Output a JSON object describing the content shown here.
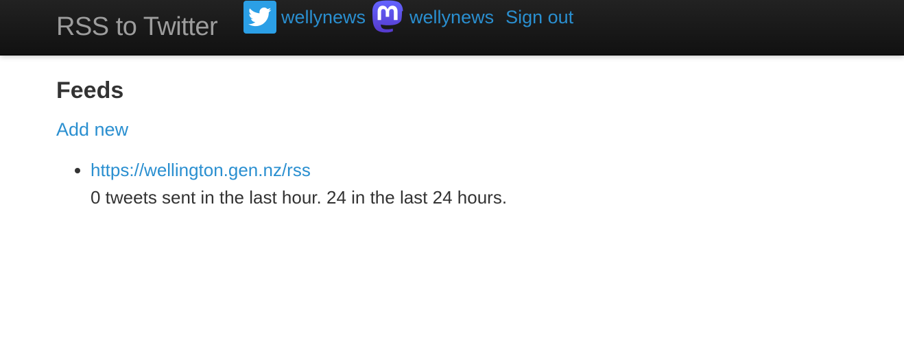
{
  "navbar": {
    "brand": "RSS to Twitter",
    "twitter_account": "wellynews",
    "mastodon_account": "wellynews",
    "sign_out": "Sign out",
    "icons": {
      "twitter": "twitter-bird-icon",
      "mastodon": "mastodon-icon"
    },
    "colors": {
      "twitter": "#2b9fe6",
      "mastodon": "#6364ff",
      "link": "#2a8fd0"
    }
  },
  "main": {
    "heading": "Feeds",
    "add_new": "Add new",
    "feeds": [
      {
        "url": "https://wellington.gen.nz/rss",
        "stats": "0 tweets sent in the last hour. 24 in the last 24 hours."
      }
    ]
  }
}
